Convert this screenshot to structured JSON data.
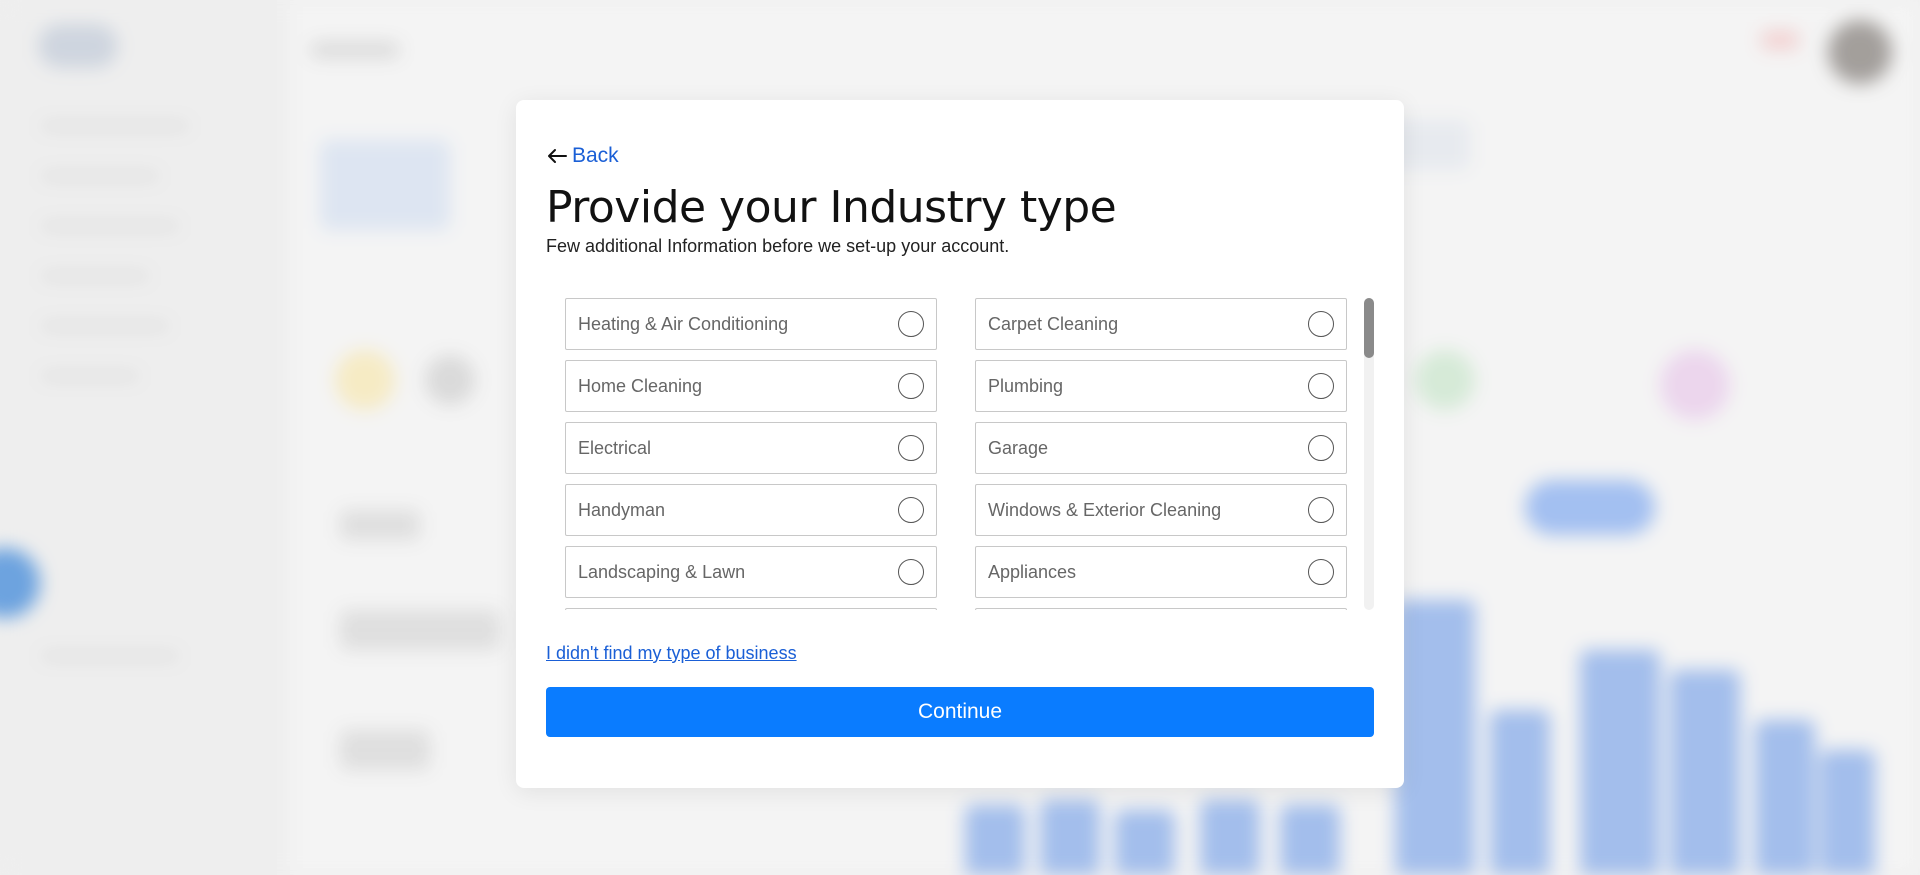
{
  "modal": {
    "back_label": "Back",
    "title": "Provide your Industry type",
    "subtitle": "Few additional Information before we set-up your account.",
    "options": [
      {
        "label": "Heating & Air Conditioning"
      },
      {
        "label": "Carpet Cleaning"
      },
      {
        "label": "Home Cleaning"
      },
      {
        "label": "Plumbing"
      },
      {
        "label": "Electrical"
      },
      {
        "label": "Garage"
      },
      {
        "label": "Handyman"
      },
      {
        "label": "Windows & Exterior Cleaning"
      },
      {
        "label": "Landscaping & Lawn"
      },
      {
        "label": "Appliances"
      }
    ],
    "not_found_link": "I didn't find my type of business",
    "continue_label": "Continue"
  },
  "colors": {
    "link": "#1a5fd6",
    "primary_button": "#0a7cff",
    "option_border": "#c8c8c8"
  },
  "icons": {
    "back": "arrow-left-icon",
    "option_selector": "radio-unchecked-icon"
  }
}
